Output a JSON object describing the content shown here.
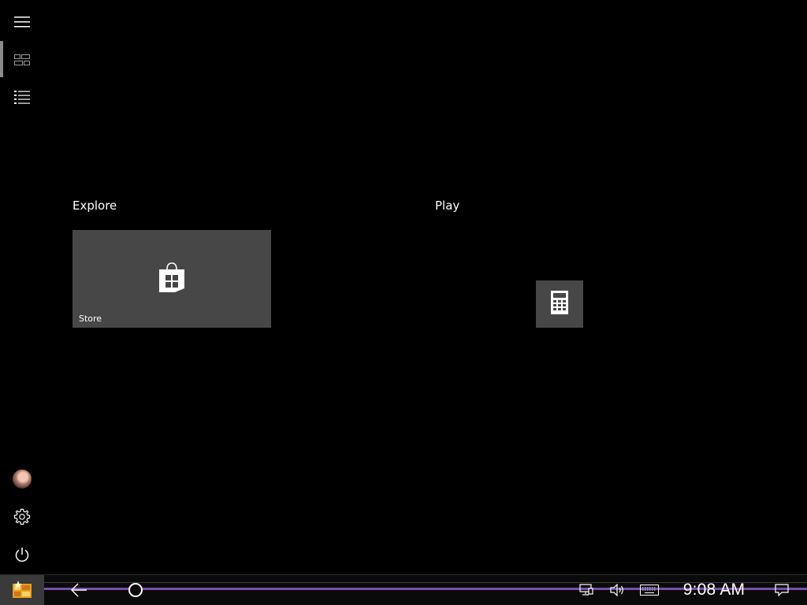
{
  "start_menu": {
    "groups": [
      {
        "header": "Explore",
        "tiles": [
          {
            "label": "Store",
            "icon": "store-bag-icon"
          }
        ]
      },
      {
        "header": "Play",
        "tiles": [
          {
            "label": "",
            "icon": "calculator-icon"
          }
        ]
      }
    ],
    "rail": {
      "top": [
        "hamburger-menu-icon",
        "tiles-view-icon",
        "all-apps-list-icon"
      ],
      "bottom": [
        "user-avatar",
        "settings-gear-icon",
        "power-icon"
      ]
    }
  },
  "taskbar": {
    "clock": "9:08 AM",
    "icons": [
      "start-logo-icon",
      "back-arrow-icon",
      "cortana-circle-icon",
      "network-icon",
      "volume-icon",
      "keyboard-icon",
      "notifications-icon"
    ],
    "accent_color": "#7a4fa8"
  },
  "colors": {
    "background": "#000000",
    "tile": "#474747"
  }
}
